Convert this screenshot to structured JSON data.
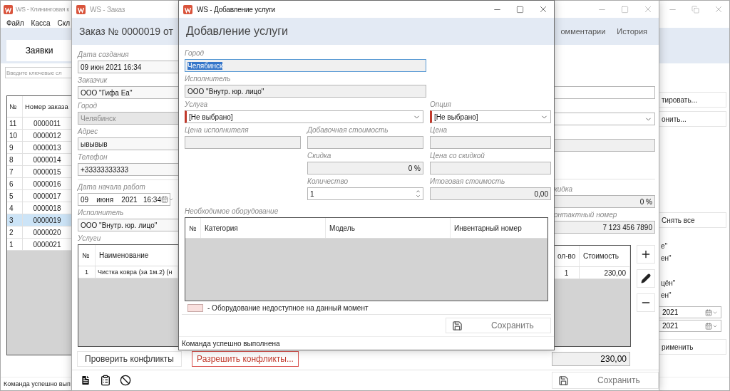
{
  "main_window": {
    "title": "WS - Клининговая к",
    "menu": [
      "Файл",
      "Касса",
      "Скл"
    ],
    "tabs": [
      {
        "label": "Заявки",
        "selected": true
      }
    ],
    "search": {
      "placeholder": "Введите ключевые сл"
    },
    "orders_table": {
      "columns": [
        "№",
        "Номер заказа"
      ],
      "rows": [
        {
          "cells": [
            "11",
            "0000011"
          ],
          "selected": false
        },
        {
          "cells": [
            "10",
            "0000012"
          ],
          "selected": false
        },
        {
          "cells": [
            "9",
            "0000013"
          ],
          "selected": false
        },
        {
          "cells": [
            "8",
            "0000014"
          ],
          "selected": false
        },
        {
          "cells": [
            "7",
            "0000015"
          ],
          "selected": false
        },
        {
          "cells": [
            "6",
            "0000016"
          ],
          "selected": false
        },
        {
          "cells": [
            "5",
            "0000017"
          ],
          "selected": false
        },
        {
          "cells": [
            "4",
            "0000018"
          ],
          "selected": false
        },
        {
          "cells": [
            "3",
            "0000019"
          ],
          "selected": true
        },
        {
          "cells": [
            "2",
            "0000020"
          ],
          "selected": false
        },
        {
          "cells": [
            "1",
            "0000021"
          ],
          "selected": false
        }
      ]
    },
    "side_buttons": [
      "тировать...",
      "онить..."
    ],
    "clear_button": "Снять все",
    "status_filters": [
      "е\"",
      "ен\"",
      "цён\"",
      "ен\""
    ],
    "date_filters": [
      "2021",
      "2021"
    ],
    "apply_button": "рименить",
    "status_bar": "Команда успешно вып"
  },
  "order_window": {
    "title": "WS - Заказ",
    "heading": "Заказ № 0000019 от",
    "tabs": [
      {
        "label": "омментарии",
        "selected": false
      },
      {
        "label": "История",
        "selected": false
      }
    ],
    "left_fields": [
      {
        "label": "Дата создания",
        "value": "09 июн 2021 16:34",
        "kind": "text",
        "disabled": false
      },
      {
        "label": "Заказчик",
        "value": "ООО \"Гифа Еа\"",
        "kind": "text",
        "disabled": false
      },
      {
        "label": "Город",
        "value": "Челябинск",
        "kind": "text",
        "disabled": true
      },
      {
        "label": "Адрес",
        "value": "ывывыв",
        "kind": "text",
        "disabled": false
      },
      {
        "label": "Телефон",
        "value": "+33333333333",
        "kind": "text",
        "disabled": false
      },
      {
        "label": "Дата начала работ",
        "value": "09    июня    2021   16:34",
        "kind": "date",
        "disabled": false
      },
      {
        "label": "Исполнитель",
        "value": "ООО \"Внутр. юр. лицо\"",
        "kind": "text",
        "disabled": false
      }
    ],
    "services_label": "Услуги",
    "services_table": {
      "columns": [
        "№",
        "Наименование"
      ],
      "rows": [
        {
          "cells": [
            "1",
            "Чистка ковра (за 1м.2) (н"
          ]
        }
      ]
    },
    "right_fields": [
      {
        "kind": "text"
      },
      {
        "kind": "combo"
      },
      {
        "kind": "readonly"
      },
      {
        "kind": "amount",
        "label": "кидка",
        "value": "0 %"
      },
      {
        "kind": "amount",
        "label": "онтактный номер",
        "value": "7 123 456 7890"
      }
    ],
    "services_side_table": {
      "columns": [
        "ол-во",
        "Стоимость"
      ],
      "rows": [
        {
          "cells": [
            "1",
            "230,00"
          ]
        }
      ]
    },
    "total": "230,00",
    "check_button": "Проверить конфликты",
    "resolve_button": "Разрешить конфликты...",
    "save_button": "Сохранить"
  },
  "dialog": {
    "title": "WS - Добавление услуги",
    "heading": "Добавление услуги",
    "fields": [
      {
        "label": "Город",
        "value": "Челябинск",
        "kind": "text",
        "focused": true,
        "invalid": false
      },
      {
        "label": "Исполнитель",
        "value": "ООО \"Внутр. юр. лицо\"",
        "kind": "readonly",
        "focused": false,
        "invalid": false
      },
      {
        "label": "Услуга",
        "value": "[Не выбрано]",
        "kind": "combo",
        "focused": false,
        "invalid": true
      },
      {
        "label": "Опция",
        "value": "[Не выбрано]",
        "kind": "combo",
        "focused": false,
        "invalid": true
      },
      {
        "label": "Цена исполнителя",
        "kind": "readonly",
        "focused": false,
        "invalid": false
      },
      {
        "label": "Добавочная стоимость",
        "kind": "readonly",
        "focused": false,
        "invalid": false
      },
      {
        "label": "Цена",
        "kind": "readonly",
        "focused": false,
        "invalid": false
      },
      {
        "label": "Скидка",
        "value": "0 %",
        "kind": "amount",
        "focused": false,
        "invalid": false
      },
      {
        "label": "Цена со скидкой",
        "kind": "readonly",
        "focused": false,
        "invalid": false
      },
      {
        "label": "Количество",
        "value": "1",
        "kind": "spin",
        "focused": false,
        "invalid": false
      },
      {
        "label": "Итоговая стоимость",
        "value": "0,00",
        "kind": "amount",
        "focused": false,
        "invalid": false
      }
    ],
    "equipment_label": "Необходимое оборудование",
    "equipment_table": {
      "columns": [
        "№",
        "Категория",
        "Модель",
        "Инвентарный номер"
      ]
    },
    "legend": "- Оборудование недоступное на данный момент",
    "save_button": "Сохранить",
    "status_bar": "Команда успешно выполнена"
  }
}
